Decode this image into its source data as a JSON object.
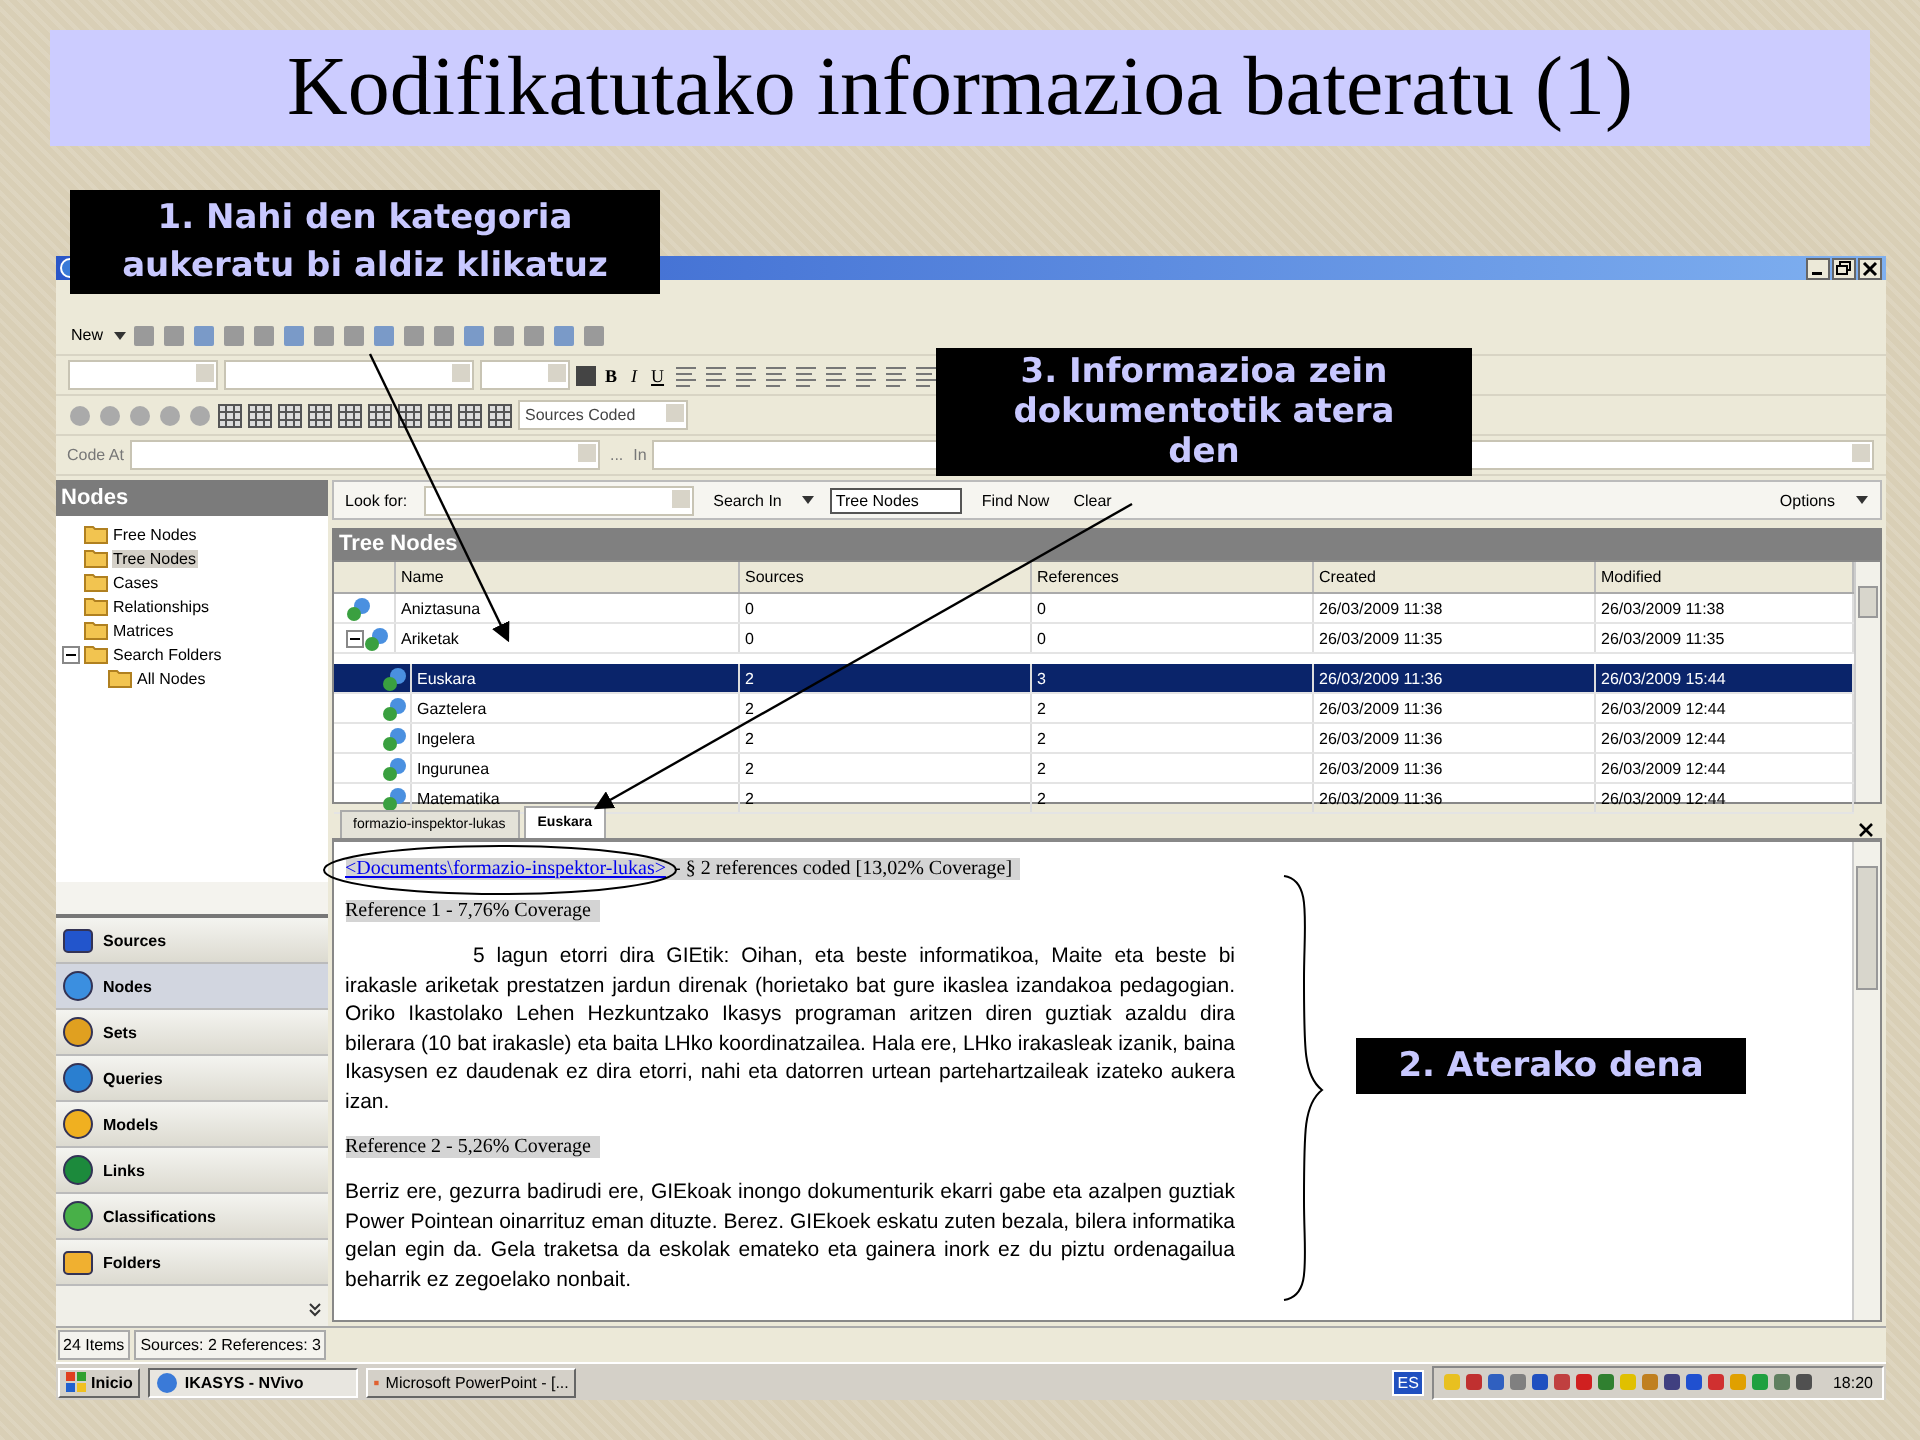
{
  "slide_title": "Kodifikatutako informazioa bateratu (1)",
  "callouts": [
    {
      "text": "1. Nahi den kategoria aukeratu bi aldiz klikatuz"
    },
    {
      "text": "3. Informazioa zein dokumentotik atera den"
    },
    {
      "text": "2. Aterako dena"
    }
  ],
  "toolbar": {
    "new_label": "New",
    "format_buttons": [
      "B",
      "I",
      "U"
    ],
    "view_dropdown": "Sources Coded",
    "code_at_label": "Code At",
    "browse_label": "...",
    "in_label": "In"
  },
  "nav_panel": {
    "title": "Nodes",
    "tree": [
      {
        "label": "Free Nodes",
        "selected": false
      },
      {
        "label": "Tree Nodes",
        "selected": true
      },
      {
        "label": "Cases",
        "selected": false
      },
      {
        "label": "Relationships",
        "selected": false
      },
      {
        "label": "Matrices",
        "selected": false
      },
      {
        "label": "Search Folders",
        "selected": false,
        "expanded": true,
        "children": [
          {
            "label": "All Nodes",
            "selected": false
          }
        ]
      }
    ],
    "buttons": [
      {
        "label": "Sources",
        "selected": false
      },
      {
        "label": "Nodes",
        "selected": true
      },
      {
        "label": "Sets",
        "selected": false
      },
      {
        "label": "Queries",
        "selected": false
      },
      {
        "label": "Models",
        "selected": false
      },
      {
        "label": "Links",
        "selected": false
      },
      {
        "label": "Classifications",
        "selected": false
      },
      {
        "label": "Folders",
        "selected": false
      }
    ]
  },
  "find_bar": {
    "look_for_label": "Look for:",
    "search_in_label": "Search In",
    "search_in_value": "Tree Nodes",
    "find_now": "Find Now",
    "clear": "Clear",
    "options": "Options"
  },
  "list_view": {
    "title": "Tree Nodes",
    "columns": [
      "Name",
      "Sources",
      "References",
      "Created",
      "Modified"
    ],
    "rows": [
      {
        "name": "Aniztasuna",
        "sources": "0",
        "references": "0",
        "created": "26/03/2009 11:38",
        "modified": "26/03/2009 11:38",
        "selected": false
      },
      {
        "name": "Ariketak",
        "sources": "0",
        "references": "0",
        "created": "26/03/2009 11:35",
        "modified": "26/03/2009 11:35",
        "selected": false,
        "expanded": true,
        "children": [
          {
            "name": "Euskara",
            "sources": "2",
            "references": "3",
            "created": "26/03/2009 11:36",
            "modified": "26/03/2009 15:44",
            "selected": true
          },
          {
            "name": "Gaztelera",
            "sources": "2",
            "references": "2",
            "created": "26/03/2009 11:36",
            "modified": "26/03/2009 12:44",
            "selected": false
          },
          {
            "name": "Ingelera",
            "sources": "2",
            "references": "2",
            "created": "26/03/2009 11:36",
            "modified": "26/03/2009 12:44",
            "selected": false
          },
          {
            "name": "Ingurunea",
            "sources": "2",
            "references": "2",
            "created": "26/03/2009 11:36",
            "modified": "26/03/2009 12:44",
            "selected": false
          },
          {
            "name": "Matematika",
            "sources": "2",
            "references": "2",
            "created": "26/03/2009 11:36",
            "modified": "26/03/2009 12:44",
            "selected": false
          }
        ]
      }
    ]
  },
  "detail": {
    "tabs": [
      {
        "label": "formazio-inspektor-lukas",
        "selected": false
      },
      {
        "label": "Euskara",
        "selected": true
      }
    ],
    "link": "<Documents\\formazio-inspektor-lukas>",
    "summary": "- § 2 references coded  [13,02% Coverage]",
    "references": [
      {
        "heading": "Reference 1 - 7,76% Coverage",
        "text": "5 lagun etorri dira GIEtik: Oihan, eta beste informatikoa, Maite eta beste bi irakasle ariketak prestatzen jardun direnak (horietako bat gure ikaslea izandakoa pedagogian. Oriko Ikastolako Lehen Hezkuntzako Ikasys programan aritzen diren guztiak azaldu dira bilerara (10 bat irakasle) eta baita LHko koordinatzailea. Hala ere, LHko irakasleak izanik, baina Ikasysen ez daudenak ez dira etorri, nahi eta datorren urtean partehartzaileak izateko aukera izan.",
        "indent": true
      },
      {
        "heading": "Reference 2 - 5,26% Coverage",
        "text": "Berriz ere, gezurra badirudi ere, GIEkoak inongo dokumenturik ekarri gabe eta azalpen guztiak Power Pointean oinarrituz eman dituzte. Berez. GIEkoek eskatu zuten bezala, bilera informatika gelan egin da. Gela traketsa da eskolak emateko eta gainera inork ez du piztu ordenagailua beharrik ez zegoelako nonbait.",
        "indent": false
      }
    ]
  },
  "status_bar": [
    "24 Items",
    "Sources: 2  References: 3"
  ],
  "taskbar": {
    "start": "Inicio",
    "tasks": [
      {
        "label": "IKASYS - NVivo",
        "selected": true
      },
      {
        "label": "Microsoft PowerPoint - [...",
        "selected": false
      }
    ],
    "language": "ES",
    "clock": "18:20"
  }
}
